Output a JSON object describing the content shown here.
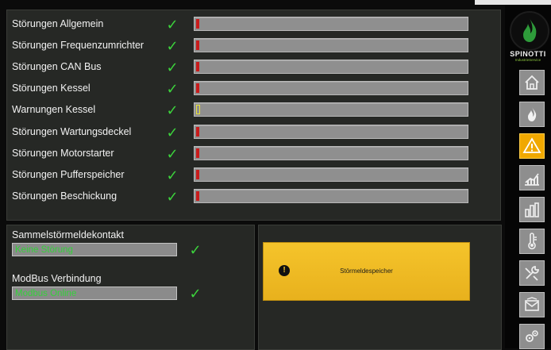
{
  "status_rows": [
    {
      "label": "Störungen Allgemein",
      "check": "✓",
      "level_color": "#c81b1b"
    },
    {
      "label": "Störungen Frequenzumrichter",
      "check": "✓",
      "level_color": "#c81b1b"
    },
    {
      "label": "Störungen CAN Bus",
      "check": "✓",
      "level_color": "#c81b1b"
    },
    {
      "label": "Störungen Kessel",
      "check": "✓",
      "level_color": "#c81b1b"
    },
    {
      "label": "Warnungen Kessel",
      "check": "✓",
      "level_color": "#e8e23a"
    },
    {
      "label": "Störungen Wartungsdeckel",
      "check": "✓",
      "level_color": "#c81b1b"
    },
    {
      "label": "Störungen Motorstarter",
      "check": "✓",
      "level_color": "#c81b1b"
    },
    {
      "label": "Störungen Pufferspeicher",
      "check": "✓",
      "level_color": "#c81b1b"
    },
    {
      "label": "Störungen Beschickung",
      "check": "✓",
      "level_color": "#c81b1b"
    }
  ],
  "summary": {
    "sammel_label": "Sammelstörmeldekontakt",
    "sammel_value": "Keine Störung",
    "modbus_label": "ModBus Verbindung",
    "modbus_value": "Modbus Online",
    "check": "✓"
  },
  "memory": {
    "button_label": "Störmeldespeicher",
    "warn_glyph": "!"
  },
  "sidebar": {
    "logo_text": "SPINOTTI",
    "logo_sub": "IndustrieService",
    "accent": "#f0a800",
    "items": [
      {
        "icon": "home-icon"
      },
      {
        "icon": "flame-icon"
      },
      {
        "icon": "warning-icon",
        "active": true
      },
      {
        "icon": "trend-chart-icon"
      },
      {
        "icon": "bar-chart-icon"
      },
      {
        "icon": "thermometer-icon"
      },
      {
        "icon": "tools-icon"
      },
      {
        "icon": "mail-icon"
      },
      {
        "icon": "gears-icon"
      }
    ]
  }
}
